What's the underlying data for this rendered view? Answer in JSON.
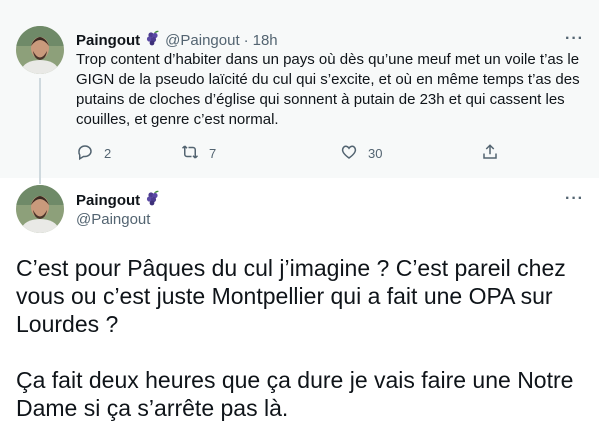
{
  "parent_tweet": {
    "author_name": "Paingout",
    "handle": "@Paingout",
    "separator": "·",
    "time": "18h",
    "more": "···",
    "text": "Trop content d’habiter dans un pays où dès qu’une meuf met un voile t’as le GIGN de la pseudo laïcité du cul qui s’excite, et où en même temps t’as des putains de cloches d’église qui sonnent à putain de 23h et qui cassent les couilles, et genre c’est normal.",
    "replies": "2",
    "retweets": "7",
    "likes": "30",
    "icons": [
      "grapes-icon",
      "reply-icon",
      "retweet-icon",
      "like-icon",
      "share-icon",
      "more-icon"
    ]
  },
  "main_tweet": {
    "author_name": "Paingout",
    "handle": "@Paingout",
    "more": "···",
    "paragraphs": [
      "C’est pour Pâques du cul j’imagine ? C’est pareil chez vous ou c’est juste Montpellier qui a fait une OPA sur Lourdes ?",
      "Ça fait deux heures que ça dure je vais faire une Notre Dame si ça s’arrête pas là."
    ]
  },
  "colors": {
    "parent_background": "#f7f9f9",
    "text_primary": "#0f1419",
    "text_secondary": "#536471",
    "thread_line": "#cfd9de",
    "grapes_purple": "#4b3c8e"
  }
}
